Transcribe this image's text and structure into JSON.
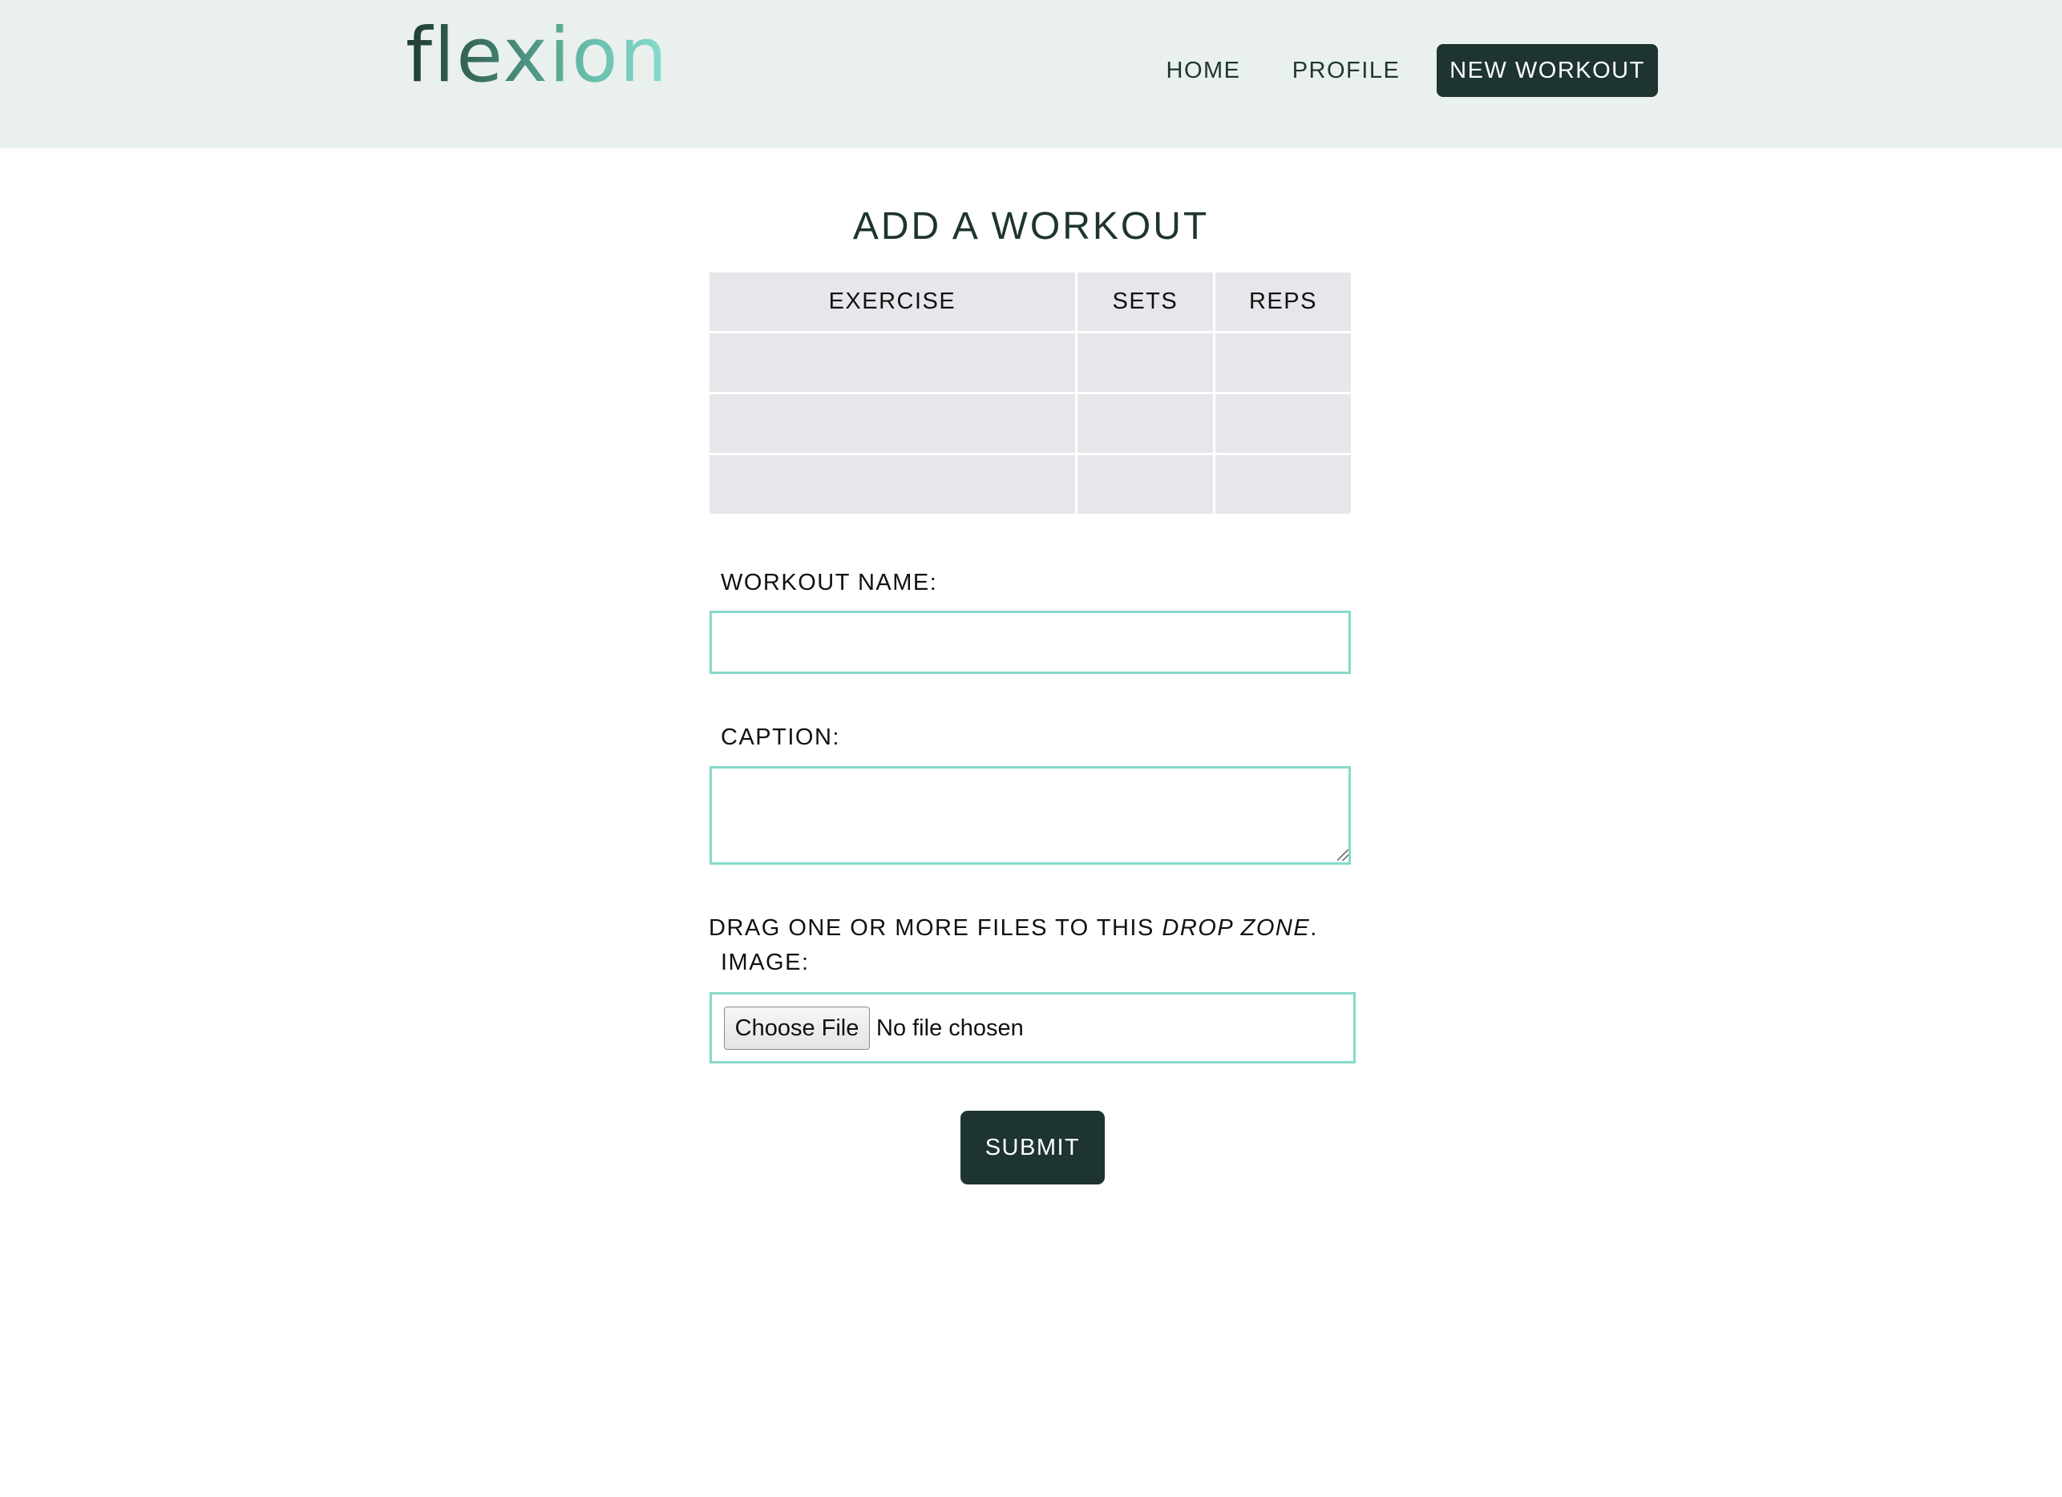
{
  "header": {
    "logo_text": "flexion",
    "nav": {
      "home": "HOME",
      "profile": "PROFILE",
      "new_workout": "NEW WORKOUT"
    }
  },
  "main": {
    "title": "ADD A WORKOUT",
    "table": {
      "headers": [
        "EXERCISE",
        "SETS",
        "REPS"
      ],
      "rows": [
        [
          "",
          "",
          ""
        ],
        [
          "",
          "",
          ""
        ],
        [
          "",
          "",
          ""
        ]
      ]
    },
    "workout_name": {
      "label": "WORKOUT NAME:",
      "value": ""
    },
    "caption": {
      "label": "CAPTION:",
      "value": ""
    },
    "drop_zone": {
      "text_before": "DRAG ONE OR MORE FILES TO THIS ",
      "emphasis": "DROP ZONE",
      "text_after": "."
    },
    "image": {
      "label": "IMAGE:",
      "button_label": "Choose File",
      "status": "No file chosen"
    },
    "submit_label": "SUBMIT"
  },
  "colors": {
    "header_bg": "#e9f0ee",
    "dark_accent": "#1e3431",
    "field_border": "#86d9ca",
    "table_cell": "#e6e7ea"
  }
}
